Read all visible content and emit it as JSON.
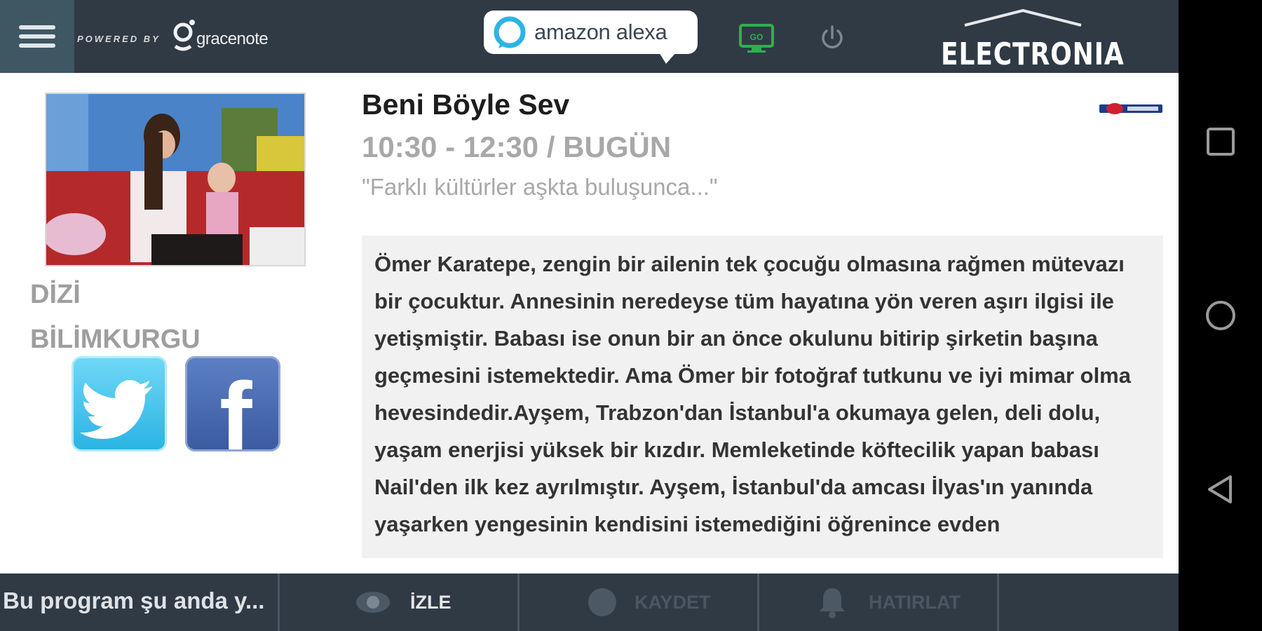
{
  "header": {
    "powered_by": "POWERED BY",
    "gracenote": "gracenote",
    "alexa": "amazon alexa",
    "brand": "ELECTRONIA"
  },
  "program": {
    "title": "Beni Böyle Sev",
    "time": "10:30 - 12:30 / BUGÜN",
    "tagline": "\"Farklı kültürler aşkta buluşunca...\"",
    "genres": [
      "DİZİ",
      "BİLİMKURGU"
    ],
    "description": "Ömer Karatepe, zengin bir ailenin tek çocuğu olmasına rağmen mütevazı bir çocuktur. Annesinin neredeyse tüm hayatına yön veren aşırı ilgisi ile yetişmiştir. Babası ise onun bir an önce okulunu bitirip şirketin başına geçmesini istemektedir. Ama Ömer bir fotoğraf tutkunu ve iyi mimar olma hevesindedir.Ayşem, Trabzon'dan İstanbul'a okumaya gelen, deli dolu, yaşam enerjisi yüksek bir kızdır. Memleketinde köftecilik yapan babası Nail'den ilk kez ayrılmıştır. Ayşem, İstanbul'da amcası İlyas'ın yanında yaşarken yengesinin kendisini istemediğini öğrenince evden"
  },
  "bottom": {
    "status": "Bu program şu anda y...",
    "watch": "İZLE",
    "record": "KAYDET",
    "remind": "HATIRLAT"
  },
  "colors": {
    "bar_bg": "#2f3a45",
    "cast_icon": "#2bb24c",
    "twitter": "#2ab4e4",
    "facebook": "#3c5ba0"
  }
}
